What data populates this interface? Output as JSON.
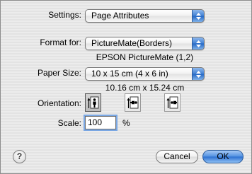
{
  "settings": {
    "label": "Settings:",
    "value": "Page Attributes"
  },
  "format_for": {
    "label": "Format for:",
    "value": "PictureMate(Borders)",
    "printer_description": "EPSON PictureMate (1,2)"
  },
  "paper_size": {
    "label": "Paper Size:",
    "value": "10 x 15 cm (4 x 6 in)",
    "dimensions": "10.16 cm x 15.24 cm"
  },
  "orientation": {
    "label": "Orientation:",
    "options": [
      {
        "icon": "portrait-orientation-icon",
        "selected": true
      },
      {
        "icon": "landscape-left-orientation-icon",
        "selected": false
      },
      {
        "icon": "landscape-right-orientation-icon",
        "selected": false
      }
    ]
  },
  "scale": {
    "label": "Scale:",
    "value": "100",
    "unit": "%"
  },
  "buttons": {
    "help": "?",
    "cancel": "Cancel",
    "ok": "OK"
  },
  "colors": {
    "accent": "#3f7fd3",
    "background": "#e8e8e8"
  }
}
